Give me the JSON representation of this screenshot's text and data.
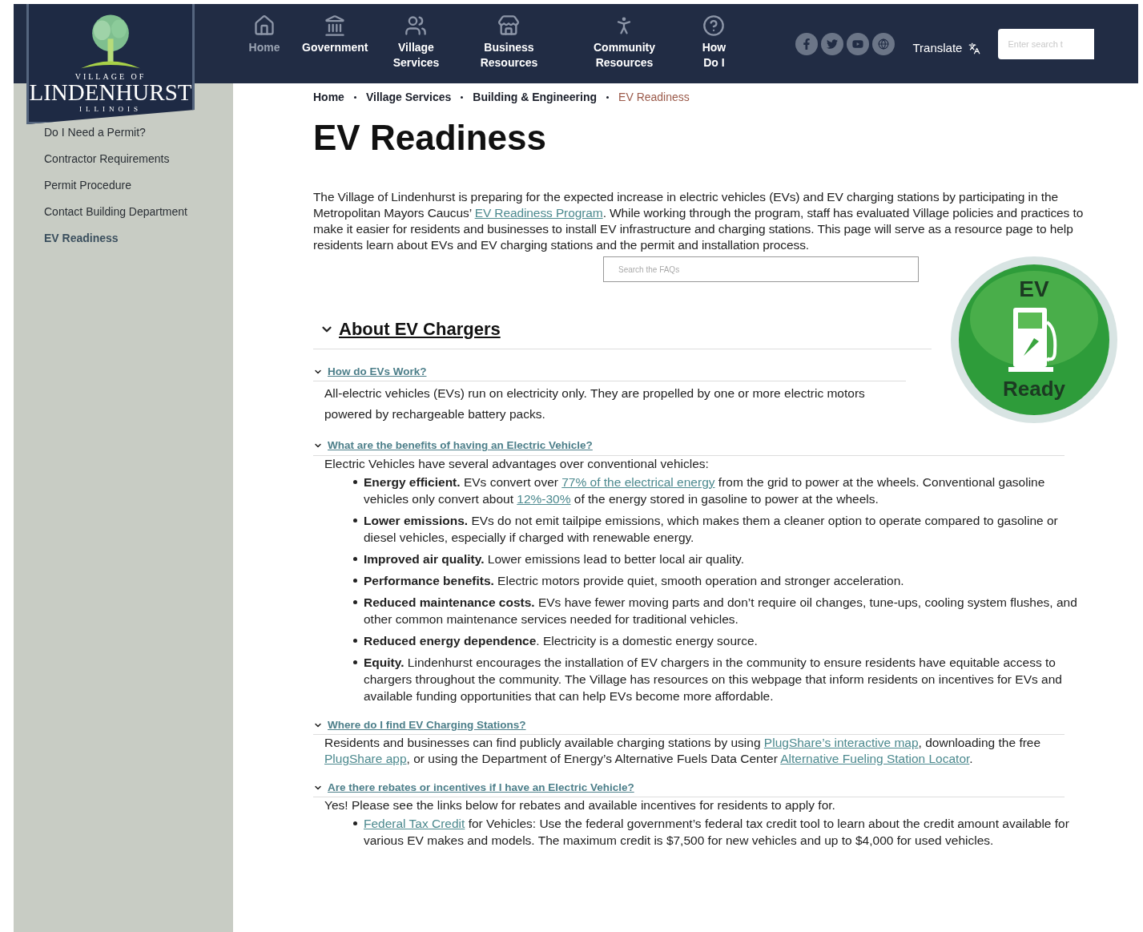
{
  "logo": {
    "top": "VILLAGE OF",
    "name": "LINDENHURST",
    "bottom": "ILLINOIS"
  },
  "nav": [
    {
      "label": "Home",
      "dim": true
    },
    {
      "label": "Government",
      "dim": false
    },
    {
      "label": "Village Services",
      "dim": false
    },
    {
      "label": "Business Resources",
      "dim": false
    },
    {
      "label": "Community Resources",
      "dim": false
    },
    {
      "label": "How Do I",
      "dim": false
    }
  ],
  "translate": "Translate",
  "header_search": {
    "placeholder": "Enter search t"
  },
  "sidebar": {
    "items": [
      {
        "label": "Do I Need a Permit?",
        "selected": false
      },
      {
        "label": "Contractor Requirements",
        "selected": false
      },
      {
        "label": "Permit Procedure",
        "selected": false
      },
      {
        "label": "Contact Building Department",
        "selected": false
      },
      {
        "label": "EV Readiness",
        "selected": true
      }
    ]
  },
  "breadcrumb": [
    {
      "label": "Home",
      "current": false
    },
    {
      "label": "Village Services",
      "current": false
    },
    {
      "label": "Building & Engineering",
      "current": false
    },
    {
      "label": "EV Readiness",
      "current": true
    }
  ],
  "page_title": "EV Readiness",
  "intro": [
    {
      "kind": "plain",
      "text": "The Village of Lindenhurst is preparing for the expected increase in electric vehicles (EVs) and EV charging stations by participating in the Metropolitan Mayors Caucus’ "
    },
    {
      "kind": "link",
      "text": "EV Readiness Program"
    },
    {
      "kind": "plain",
      "text": ". While working through the program, staff has evaluated Village policies and practices to make it easier for residents and businesses to install EV infrastructure and charging stations. This page will serve as a resource page to help residents learn about EVs and EV charging stations and the permit and installation process."
    }
  ],
  "faq_search": {
    "placeholder": "Search the FAQs"
  },
  "badge": {
    "top": "EV",
    "bottom": "Ready"
  },
  "section": {
    "title": "About EV Chargers",
    "expanded": true,
    "items": [
      {
        "question": "How do EVs Work?",
        "expanded": true,
        "answer": [
          {
            "kind": "plain",
            "text": "All-electric vehicles (EVs) run on electricity only. They are propelled by one or more electric motors powered by rechargeable battery packs."
          }
        ]
      },
      {
        "question": "What are the benefits of having an Electric Vehicle?",
        "expanded": true,
        "answer": [
          {
            "kind": "plain",
            "text": "Electric Vehicles have several advantages over conventional vehicles:"
          }
        ],
        "bullets": [
          [
            {
              "kind": "bold",
              "text": "Energy efficient."
            },
            {
              "kind": "plain",
              "text": " EVs convert over "
            },
            {
              "kind": "link",
              "text": "77% of the electrical energy"
            },
            {
              "kind": "plain",
              "text": " from the grid to power at the wheels. Conventional gasoline vehicles only convert about "
            },
            {
              "kind": "link",
              "text": "12%-30%"
            },
            {
              "kind": "plain",
              "text": " of the energy stored in gasoline to power at the wheels."
            }
          ],
          [
            {
              "kind": "bold",
              "text": "Lower emissions."
            },
            {
              "kind": "plain",
              "text": "  EVs do not emit tailpipe emissions, which makes them a cleaner option to operate compared to gasoline or diesel vehicles, especially if charged with renewable energy."
            }
          ],
          [
            {
              "kind": "bold",
              "text": "Improved air quality."
            },
            {
              "kind": "plain",
              "text": " Lower emissions lead to better local air quality."
            }
          ],
          [
            {
              "kind": "bold",
              "text": "Performance benefits."
            },
            {
              "kind": "plain",
              "text": " Electric motors provide quiet, smooth operation and stronger acceleration."
            }
          ],
          [
            {
              "kind": "bold",
              "text": "Reduced maintenance costs."
            },
            {
              "kind": "plain",
              "text": " EVs have fewer moving parts and don’t require oil changes, tune-ups, cooling system flushes, and other common maintenance services needed for traditional vehicles."
            }
          ],
          [
            {
              "kind": "bold",
              "text": "Reduced energy dependence"
            },
            {
              "kind": "plain",
              "text": ". Electricity is a domestic energy source."
            }
          ],
          [
            {
              "kind": "bold",
              "text": "Equity."
            },
            {
              "kind": "plain",
              "text": "  Lindenhurst encourages the installation of EV chargers in the community to ensure residents have equitable access to chargers throughout the community. The Village has resources on this webpage that inform residents on incentives for EVs and available funding opportunities that can help EVs become more affordable."
            }
          ]
        ]
      },
      {
        "question": "Where do I find EV Charging Stations?",
        "expanded": true,
        "answer": [
          {
            "kind": "plain",
            "text": "Residents and businesses can find publicly available charging stations by using "
          },
          {
            "kind": "link",
            "text": "PlugShare’s interactive map"
          },
          {
            "kind": "plain",
            "text": ", downloading the free "
          },
          {
            "kind": "link",
            "text": "PlugShare app"
          },
          {
            "kind": "plain",
            "text": ", or using the Department of Energy’s Alternative Fuels Data Center "
          },
          {
            "kind": "link",
            "text": "Alternative Fueling Station Locator"
          },
          {
            "kind": "plain",
            "text": "."
          }
        ]
      },
      {
        "question": "Are there rebates or incentives if I have an Electric Vehicle?",
        "expanded": true,
        "answer": [
          {
            "kind": "plain",
            "text": "Yes! Please see the links below for rebates and available incentives for residents to apply for."
          }
        ],
        "bullets": [
          [
            {
              "kind": "link",
              "text": "Federal Tax Credit"
            },
            {
              "kind": "plain",
              "text": " for Vehicles: Use the federal government’s federal tax credit tool to learn about the credit amount available for various EV makes and models. The maximum credit is $7,500 for new vehicles and up to $4,000 for used vehicles."
            }
          ]
        ]
      }
    ]
  }
}
